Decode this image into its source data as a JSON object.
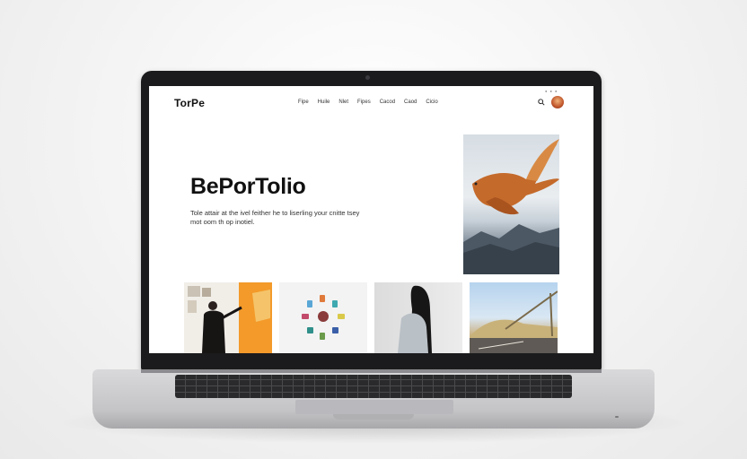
{
  "site": {
    "logo": "TorPe",
    "nav": [
      "Fipe",
      "Huile",
      "Nlet",
      "Fipes",
      "Cacod",
      "Caod",
      "Cicio"
    ],
    "hero_title": "BePorTolio",
    "hero_subtitle": "Tole attair at the ivel feither he to liserling your cnitte tsey mot oom th op inotiel.",
    "icons": {
      "search": "search-icon",
      "avatar": "user-avatar"
    }
  },
  "gallery": [
    {
      "name": "artist-at-easel",
      "alt": ""
    },
    {
      "name": "bead-circle",
      "alt": ""
    },
    {
      "name": "woman-long-hair",
      "alt": ""
    },
    {
      "name": "crane-bridge",
      "alt": ""
    }
  ],
  "colors": {
    "accent": "#f39a2a",
    "text": "#111111",
    "bezel": "#1b1b1d"
  }
}
